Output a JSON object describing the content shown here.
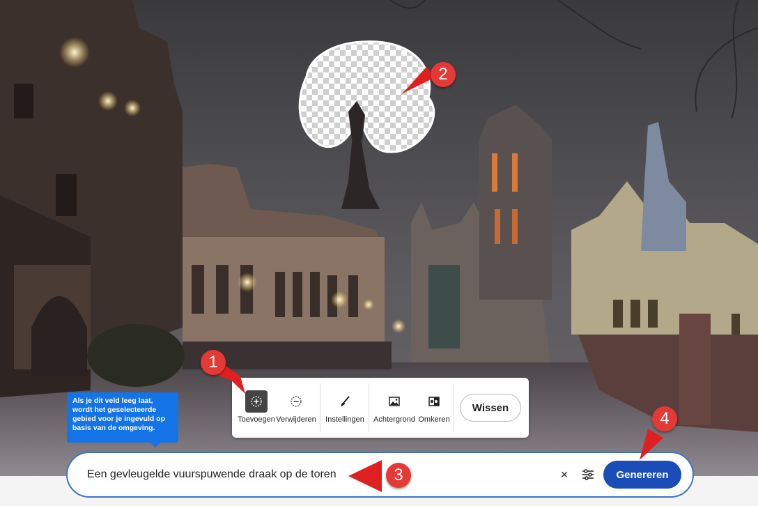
{
  "toolbar": {
    "tools": [
      {
        "label": "Toevoegen",
        "icon": "add-circle-icon",
        "active": true
      },
      {
        "label": "Verwijderen",
        "icon": "subtract-circle-icon",
        "active": false
      },
      {
        "label": "Instellingen",
        "icon": "brush-icon",
        "active": false
      },
      {
        "label": "Achtergrond",
        "icon": "image-icon",
        "active": false
      },
      {
        "label": "Omkeren",
        "icon": "invert-icon",
        "active": false
      }
    ],
    "clear_label": "Wissen"
  },
  "tooltip": {
    "text": "Als je dit veld leeg laat, wordt het geselecteerde gebied voor je ingevuld op basis van de omgeving."
  },
  "prompt": {
    "value": "Een gevleugelde vuurspuwende draak op de toren",
    "clear_label": "×",
    "generate_label": "Genereren"
  },
  "annotations": {
    "badges": [
      "1",
      "2",
      "3",
      "4"
    ],
    "color": "#e53935"
  },
  "colors": {
    "accent": "#1a4db8",
    "tooltip": "#1473e6",
    "prompt_border": "#3f73c8"
  }
}
